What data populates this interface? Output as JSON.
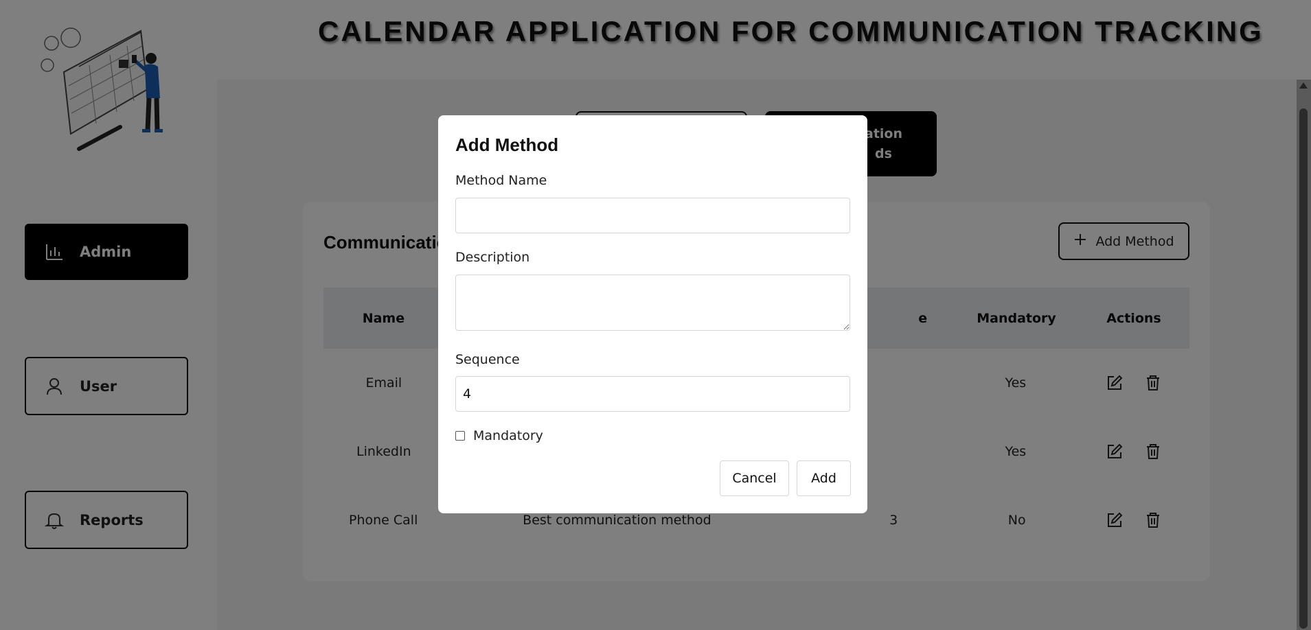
{
  "app": {
    "title": "CALENDAR APPLICATION FOR COMMUNICATION TRACKING"
  },
  "sidebar": {
    "items": [
      {
        "label": "Admin",
        "icon": "bar-chart-icon",
        "active": true
      },
      {
        "label": "User",
        "icon": "user-icon",
        "active": false
      },
      {
        "label": "Reports",
        "icon": "bell-icon",
        "active": false
      }
    ]
  },
  "tabs": [
    {
      "label": "",
      "active": false
    },
    {
      "label": "ation\nds",
      "active": true
    }
  ],
  "card": {
    "title": "Communicatio",
    "add_button_label": "Add Method"
  },
  "table": {
    "headers": [
      "Name",
      "",
      "e",
      "Mandatory",
      "Actions"
    ],
    "rows": [
      {
        "name": "Email",
        "description": "",
        "sequence": "",
        "mandatory": "Yes"
      },
      {
        "name": "LinkedIn",
        "description": "",
        "sequence": "",
        "mandatory": "Yes"
      },
      {
        "name": "Phone Call",
        "description": "Best communication method",
        "sequence": "3",
        "mandatory": "No"
      }
    ]
  },
  "modal": {
    "title": "Add Method",
    "method_name_label": "Method Name",
    "method_name_value": "",
    "description_label": "Description",
    "description_value": "",
    "sequence_label": "Sequence",
    "sequence_value": "4",
    "mandatory_label": "Mandatory",
    "mandatory_checked": false,
    "cancel_label": "Cancel",
    "add_label": "Add"
  },
  "colors": {
    "overlay": "#00000080",
    "active_nav": "#000000",
    "table_header": "#e8edf1"
  }
}
